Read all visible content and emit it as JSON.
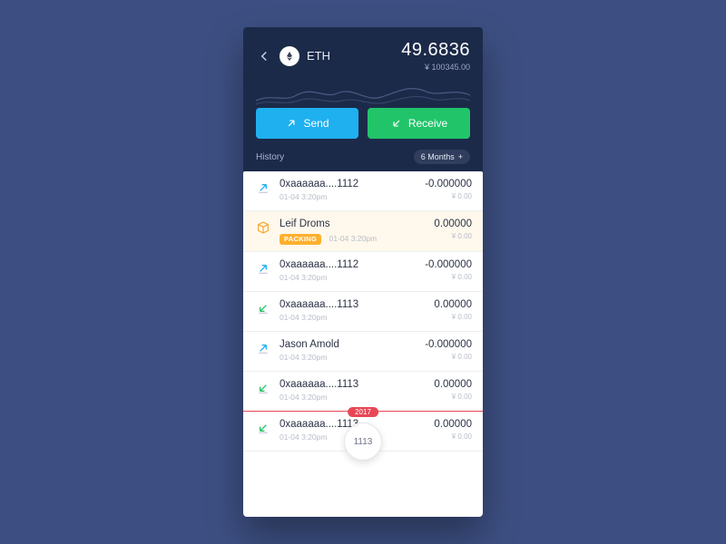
{
  "header": {
    "coin_label": "ETH",
    "balance_main": "49.6836",
    "balance_fiat": "¥ 100345.00"
  },
  "actions": {
    "send_label": "Send",
    "receive_label": "Receive"
  },
  "history": {
    "label": "History",
    "period_label": "6 Months"
  },
  "float_bubble": "1113",
  "year_marker": "2017",
  "transactions": [
    {
      "icon": "send",
      "title": "0xaaaaaa....1112",
      "time": "01-04 3:20pm",
      "amount": "-0.000000",
      "fiat": "¥ 0.00"
    },
    {
      "icon": "package",
      "title": "Leif Droms",
      "badge": "PACKING",
      "badge_time": "01-04 3:20pm",
      "amount": "0.00000",
      "fiat": "¥ 0.00",
      "highlight": true
    },
    {
      "icon": "send",
      "title": "0xaaaaaa....1112",
      "time": "01-04 3:20pm",
      "amount": "-0.000000",
      "fiat": "¥ 0.00"
    },
    {
      "icon": "receive",
      "title": "0xaaaaaa....1113",
      "time": "01-04 3:20pm",
      "amount": "0.00000",
      "fiat": "¥ 0.00"
    },
    {
      "icon": "send",
      "title": "Jason Amold",
      "time": "01-04 3:20pm",
      "amount": "-0.000000",
      "fiat": "¥ 0.00"
    },
    {
      "icon": "receive",
      "title": "0xaaaaaa....1113",
      "time": "01-04 3:20pm",
      "amount": "0.00000",
      "fiat": "¥ 0.00",
      "year_divider": true
    },
    {
      "icon": "receive",
      "title": "0xaaaaaa....1113",
      "time": "01-04 3:20pm",
      "amount": "0.00000",
      "fiat": "¥ 0.00"
    }
  ]
}
